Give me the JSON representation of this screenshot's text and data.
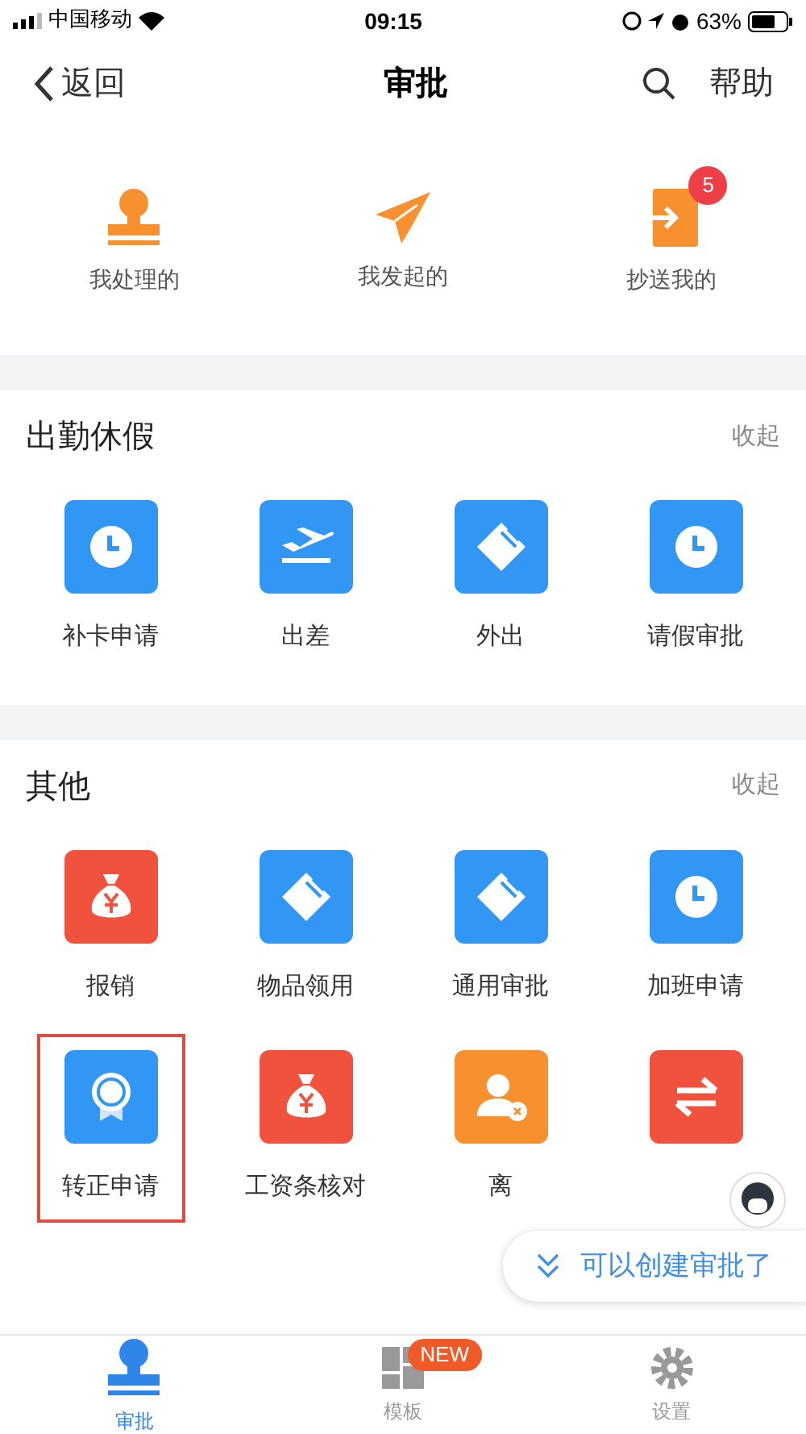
{
  "status_bar": {
    "carrier": "中国移动",
    "time": "09:15",
    "battery": "63%"
  },
  "nav": {
    "back": "返回",
    "title": "审批",
    "help": "帮助"
  },
  "quick": [
    {
      "label": "我处理的",
      "kind": "stamp"
    },
    {
      "label": "我发起的",
      "kind": "send"
    },
    {
      "label": "抄送我的",
      "kind": "inbox",
      "badge": "5"
    }
  ],
  "sections": [
    {
      "title": "出勤休假",
      "action": "收起",
      "items": [
        {
          "label": "补卡申请",
          "kind": "clock",
          "color": "#3296f5",
          "highlighted": false
        },
        {
          "label": "出差",
          "kind": "plane",
          "color": "#3296f5",
          "highlighted": false
        },
        {
          "label": "外出",
          "kind": "tag",
          "color": "#3296f5",
          "highlighted": false
        },
        {
          "label": "请假审批",
          "kind": "clock",
          "color": "#3296f5",
          "highlighted": false
        }
      ]
    },
    {
      "title": "其他",
      "action": "收起",
      "items": [
        {
          "label": "报销",
          "kind": "money",
          "color": "#f0523e",
          "highlighted": false
        },
        {
          "label": "物品领用",
          "kind": "tag",
          "color": "#3296f5",
          "highlighted": false
        },
        {
          "label": "通用审批",
          "kind": "tag",
          "color": "#3296f5",
          "highlighted": false
        },
        {
          "label": "加班申请",
          "kind": "clock",
          "color": "#3296f5",
          "highlighted": false
        },
        {
          "label": "转正申请",
          "kind": "medal",
          "color": "#3296f5",
          "highlighted": true
        },
        {
          "label": "工资条核对",
          "kind": "money",
          "color": "#f0523e",
          "highlighted": false
        },
        {
          "label": "离",
          "kind": "person",
          "color": "#f7902f",
          "highlighted": false
        },
        {
          "kind": "swap",
          "color": "#f0523e",
          "highlighted": false
        }
      ]
    }
  ],
  "toast": "可以创建审批了",
  "tabs": [
    {
      "label": "审批",
      "kind": "stamp",
      "selected": true
    },
    {
      "label": "模板",
      "kind": "grid",
      "selected": false,
      "badge": "NEW"
    },
    {
      "label": "设置",
      "kind": "gear",
      "selected": false
    }
  ]
}
